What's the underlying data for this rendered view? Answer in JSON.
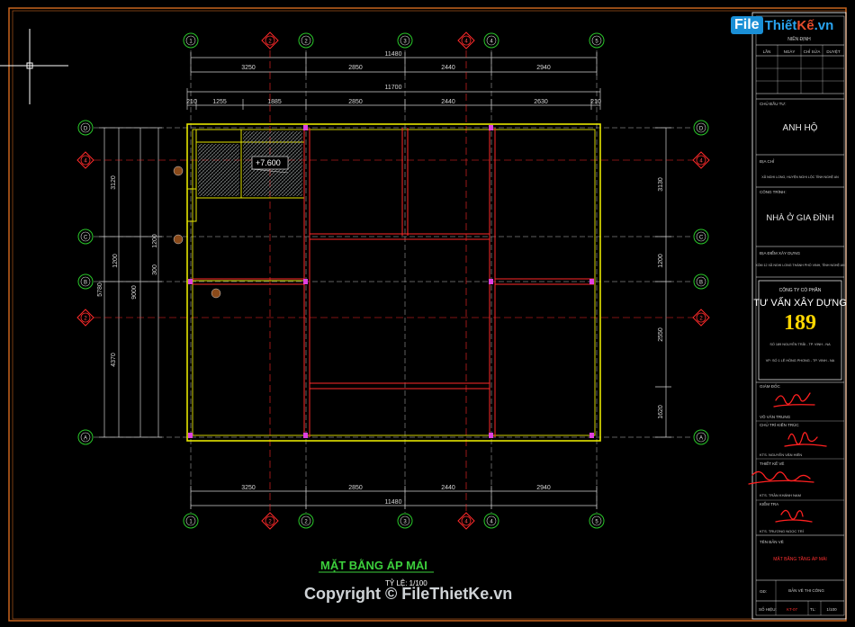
{
  "logo": {
    "badge": "File",
    "text1": "Thiết",
    "text2": "Kế",
    "suffix": ".vn"
  },
  "copyright": "Copyright © FileThietKe.vn",
  "drawing": {
    "title": "MẶT BẰNG ÁP MÁI",
    "scale": "TỶ LỆ: 1/100",
    "elevation_tag": "+7.600",
    "top_axes": [
      "1",
      "2",
      "3",
      "4",
      "5"
    ],
    "side_axes": [
      "D",
      "C",
      "B",
      "A"
    ],
    "red_axes_v": [
      "2'",
      "4'"
    ],
    "red_axes_h": [
      "4'",
      "2'"
    ],
    "top_dims_row1": [
      "3250",
      "2850",
      "2440",
      "2940"
    ],
    "top_total_row1": "11480",
    "top_total_row2": "11700",
    "top_dims_row3": [
      "210",
      "1255",
      "1885",
      "2850",
      "2440",
      "2630",
      "210"
    ],
    "bottom_dims": [
      "3250",
      "2850",
      "2440",
      "2940"
    ],
    "bottom_total": "11480",
    "left_dims_outer": [
      "3120",
      "5780",
      "4370"
    ],
    "left_dims_mid": [
      "9000"
    ],
    "left_dims_inner": [
      "1200",
      "300",
      "1200"
    ],
    "right_dims": [
      "3130",
      "1200",
      "2550",
      "1620"
    ]
  },
  "titleblock": {
    "header": "NIÊN ĐỊNH",
    "cols": [
      "LẦN",
      "NGÀY",
      "CHỈ SỬA",
      "DUYỆT"
    ],
    "owner_label": "CHỦ ĐẦU TƯ:",
    "owner": "ANH HỘ",
    "address_label": "ĐỊA CHỈ",
    "address": "XÃ NGHI LONG, HUYỆN NGHI LỘC TỈNH NGHỆ AN",
    "project_label": "CÔNG TRÌNH:",
    "project": "NHÀ Ở GIA ĐÌNH",
    "site_label": "ĐỊA ĐIỂM XÂY DỰNG",
    "site": "XÓM 12 XÃ NGHI LONG THÀNH PHỐ VINH, TỈNH NGHỆ AN",
    "company_l1": "CÔNG TY CỔ PHẦN",
    "company_l2": "TƯ VẤN XÂY DỰNG",
    "company_num": "189",
    "company_addr1": "SỐ 189 NGUYỄN TRÃI - TP. VINH - NA",
    "company_addr2": "VP: SỐ 1 LÊ HỒNG PHONG - TP. VINH - NA",
    "director_label": "GIÁM ĐỐC",
    "director": "VÕ VĂN TRUNG",
    "chief_label": "CHỦ TRÌ KIẾN TRÚC",
    "chief": "KTS. NGUYỄN VĂN HIÊN",
    "draw_label": "THIẾT KẾ VẼ",
    "drawer": "KTS. TRẦN KHÁNH NAM",
    "check_label": "KIỂM TRA",
    "checker": "KTS. TRƯƠNG NGỌC TRÍ",
    "sheet_label": "TÊN BẢN VẼ",
    "sheet_name": "MẶT BẰNG TẦNG ÁP MÁI",
    "stage_label": "GĐ:",
    "stage": "BẢN VẼ THI CÔNG",
    "code_label": "SỐ HIỆU:",
    "code": "KT-07",
    "scale_label": "TL:",
    "scale": "1/100"
  },
  "colors": {
    "frame": "#d2691e",
    "wall": "#e6e600",
    "beam": "#ff2a2a",
    "grid": "#e0e0e0",
    "axis": "#29c729",
    "dim": "#d8d8d8",
    "text_green": "#3ccf3c"
  }
}
